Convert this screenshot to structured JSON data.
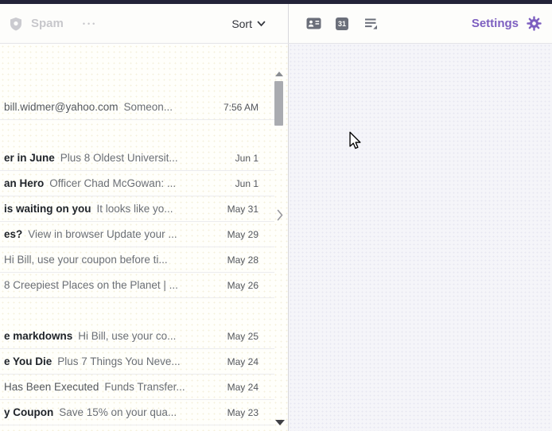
{
  "list_toolbar": {
    "folder": "Spam",
    "more": "•••",
    "sort": "Sort"
  },
  "right_toolbar": {
    "calendar_day": "31",
    "settings": "Settings"
  },
  "colors": {
    "accent_purple": "#7d5fc0",
    "icon_gray": "#6b6f7a",
    "top_strip": "#232338",
    "faded_header": "#c7c7cb"
  },
  "email_groups": [
    {
      "emails": [
        {
          "subject": "bill.widmer@yahoo.com",
          "bold": false,
          "snippet": "Someon...",
          "date": "7:56 AM"
        }
      ]
    },
    {
      "emails": [
        {
          "subject": "er in June",
          "bold": true,
          "snippet": "Plus 8 Oldest Universit...",
          "date": "Jun 1"
        },
        {
          "subject": "an Hero",
          "bold": true,
          "snippet": "Officer Chad McGowan: ...",
          "date": "Jun 1"
        },
        {
          "subject": "is waiting on you",
          "bold": true,
          "snippet": "It looks like yo...",
          "date": "May 31"
        },
        {
          "subject": "es?",
          "bold": true,
          "snippet": "View in browser Update your ...",
          "date": "May 29"
        },
        {
          "subject": "",
          "bold": false,
          "snippet": "Hi Bill, use your coupon before ti...",
          "date": "May 28"
        },
        {
          "subject": "",
          "bold": false,
          "snippet": "8 Creepiest Places on the Planet | ...",
          "date": "May 26"
        }
      ]
    },
    {
      "emails": [
        {
          "subject": "e markdowns",
          "bold": true,
          "snippet": "Hi Bill, use your co...",
          "date": "May 25"
        },
        {
          "subject": "e You Die",
          "bold": true,
          "snippet": "Plus 7 Things You Neve...",
          "date": "May 24"
        },
        {
          "subject": "Has Been Executed",
          "bold": false,
          "snippet": "Funds Transfer...",
          "date": "May 24"
        },
        {
          "subject": "y Coupon",
          "bold": true,
          "snippet": "Save 15% on your qua...",
          "date": "May 23"
        }
      ]
    }
  ]
}
